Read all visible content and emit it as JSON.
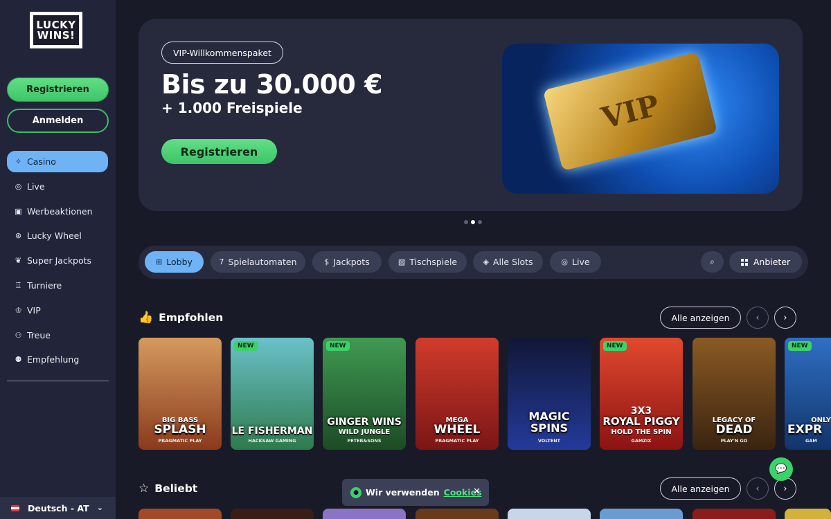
{
  "brand": {
    "logo_line1": "LUCKY",
    "logo_line2": "WINS!"
  },
  "sidebar": {
    "register_label": "Registrieren",
    "login_label": "Anmelden",
    "items": [
      {
        "label": "Casino",
        "icon": "casino-icon"
      },
      {
        "label": "Live",
        "icon": "live-icon"
      },
      {
        "label": "Werbeaktionen",
        "icon": "gift-icon"
      },
      {
        "label": "Lucky Wheel",
        "icon": "wheel-icon"
      },
      {
        "label": "Super Jackpots",
        "icon": "jackpot-icon"
      },
      {
        "label": "Turniere",
        "icon": "trophy-icon"
      },
      {
        "label": "VIP",
        "icon": "crown-icon"
      },
      {
        "label": "Treue",
        "icon": "loyalty-icon"
      },
      {
        "label": "Empfehlung",
        "icon": "referral-icon"
      }
    ],
    "language": "Deutsch - AT"
  },
  "hero": {
    "tag": "VIP-Willkommenspaket",
    "title": "Bis zu 30.000 €",
    "subtitle": "+ 1.000 Freispiele",
    "cta": "Registrieren",
    "image_text": "VIP"
  },
  "categories": {
    "items": [
      "Lobby",
      "Spielautomaten",
      "Jackpots",
      "Tischspiele",
      "Alle Slots",
      "Live"
    ],
    "provider_label": "Anbieter"
  },
  "sections": {
    "recommended": {
      "title": "Empfohlen",
      "all_label": "Alle anzeigen"
    },
    "popular": {
      "title": "Beliebt",
      "all_label": "Alle anzeigen"
    }
  },
  "games": [
    {
      "sup": "BIG BASS",
      "title": "SPLASH",
      "provider": "PRAGMATIC PLAY",
      "new": false,
      "color": "#b9683a"
    },
    {
      "sup": "",
      "title": "LE FISHERMAN",
      "provider": "HACKSAW GAMING",
      "new": true,
      "color": "#4b8f6a"
    },
    {
      "sup": "",
      "title": "GINGER WINS",
      "sub": "WILD JUNGLE",
      "provider": "PETER&SONS",
      "new": true,
      "color": "#2f7a3a"
    },
    {
      "sup": "MEGA",
      "title": "WHEEL",
      "provider": "PRAGMATIC PLAY",
      "new": false,
      "color": "#b42a2a"
    },
    {
      "sup": "",
      "title": "MAGIC SPINS",
      "provider": "VOLTENT",
      "new": false,
      "color": "#1f2a6a"
    },
    {
      "sup": "3X3",
      "title": "ROYAL PIGGY",
      "sub": "HOLD THE SPIN",
      "provider": "GAMZIX",
      "new": true,
      "color": "#c4261e"
    },
    {
      "sup": "LEGACY OF",
      "title": "DEAD",
      "provider": "PLAY'N GO",
      "new": false,
      "color": "#5c3a1c"
    },
    {
      "sup": "ONLY",
      "title": "EXPR",
      "provider": "GAM",
      "new": true,
      "color": "#1e4a8a"
    }
  ],
  "cookie": {
    "text": "Wir verwenden",
    "link": "Cookies"
  }
}
